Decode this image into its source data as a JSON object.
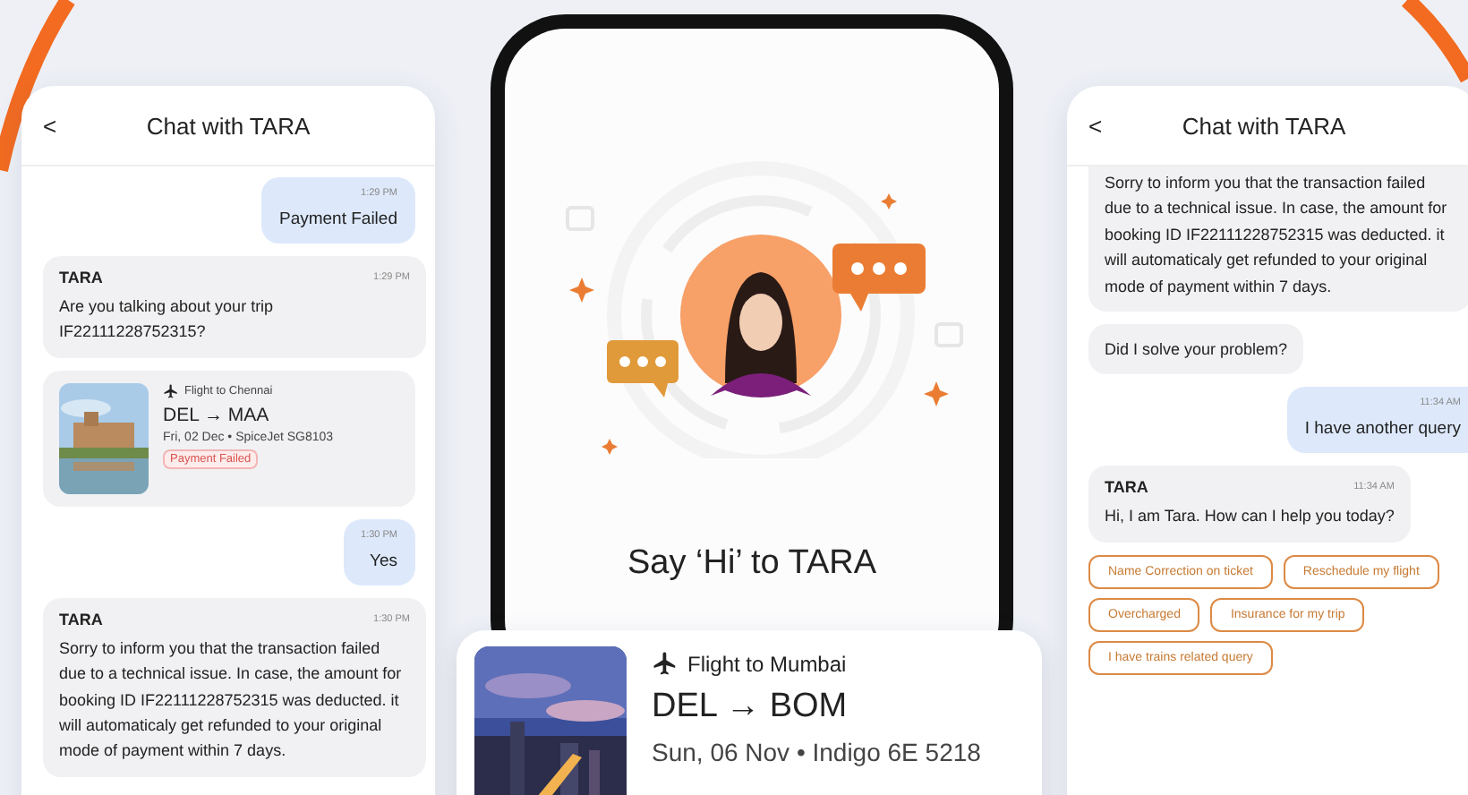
{
  "left_chat": {
    "back": "<",
    "title": "Chat with TARA",
    "messages": [
      {
        "kind": "user",
        "time": "1:29 PM",
        "text": "Payment Failed"
      },
      {
        "kind": "bot",
        "sender": "TARA",
        "time": "1:29 PM",
        "text": "Are you talking about your trip IF22111228752315?"
      },
      {
        "kind": "trip",
        "label": "Flight to Chennai",
        "route": "DEL → MAA",
        "details": "Fri, 02 Dec • SpiceJet SG8103",
        "status": "Payment Failed"
      },
      {
        "kind": "user",
        "time": "1:30 PM",
        "text": "Yes"
      },
      {
        "kind": "bot",
        "sender": "TARA",
        "time": "1:30 PM",
        "text": "Sorry to inform you that the transaction failed due to a technical issue. In case, the amount for booking ID IF22111228752315 was deducted. it will automaticaly get refunded to your original mode of payment within 7 days."
      }
    ]
  },
  "center": {
    "headline": "Say ‘Hi’ to TARA"
  },
  "flight_card": {
    "label": "Flight to Mumbai",
    "route": "DEL → BOM",
    "details": "Sun, 06 Nov • Indigo 6E 5218"
  },
  "right_chat": {
    "back": "<",
    "title": "Chat with TARA",
    "messages": [
      {
        "kind": "bot",
        "text": "Sorry to inform you that the transaction failed due to a technical issue. In case, the amount for booking ID IF22111228752315 was deducted. it will automaticaly get refunded to your original mode of payment within 7 days."
      },
      {
        "kind": "bot",
        "text": "Did I solve your problem?"
      },
      {
        "kind": "user",
        "time": "11:34 AM",
        "text": "I have another query"
      },
      {
        "kind": "bot",
        "sender": "TARA",
        "time": "11:34 AM",
        "text": "Hi, I am Tara. How can I help you today?"
      }
    ],
    "chips": [
      "Name Correction on ticket",
      "Reschedule my flight",
      "Overcharged",
      "Insurance for my trip",
      "I have trains related query"
    ]
  }
}
